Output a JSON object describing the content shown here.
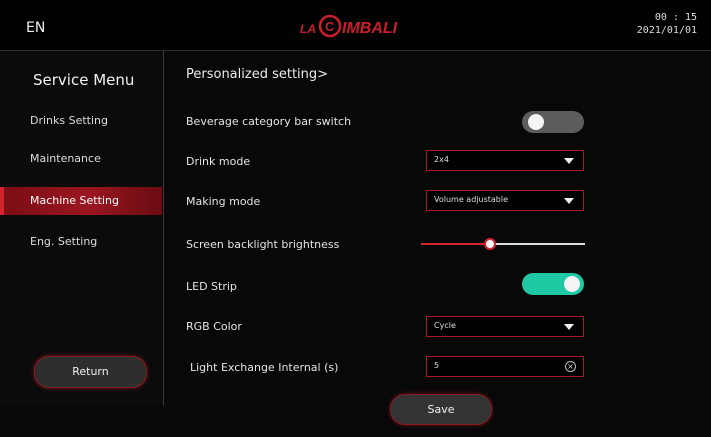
{
  "header": {
    "language": "EN",
    "logo_text": "LA CIMBALI",
    "time": "00 : 15",
    "date": "2021/01/01"
  },
  "sidebar": {
    "title": "Service Menu",
    "items": [
      {
        "label": "Drinks Setting",
        "active": false
      },
      {
        "label": "Maintenance",
        "active": false
      },
      {
        "label": "Machine Setting",
        "active": true
      },
      {
        "label": "Eng. Setting",
        "active": false
      }
    ],
    "return_label": "Return"
  },
  "main": {
    "breadcrumb": "Personalized setting>",
    "rows": {
      "beverage_bar": {
        "label": "Beverage category bar switch",
        "enabled": false
      },
      "drink_mode": {
        "label": "Drink mode",
        "value": "2x4"
      },
      "making_mode": {
        "label": "Making mode",
        "value": "Volume adjustable"
      },
      "brightness": {
        "label": "Screen backlight brightness",
        "level_percent": 42
      },
      "led_strip": {
        "label": "LED Strip",
        "enabled": true
      },
      "rgb_color": {
        "label": "RGB Color",
        "value": "Cycle"
      },
      "light_interval": {
        "label": "Light Exchange Internal (s)",
        "value": "5"
      }
    },
    "save_label": "Save"
  },
  "colors": {
    "accent_red": "#d2232f",
    "toggle_on": "#1fc9a4",
    "toggle_off": "#5c5c5c"
  },
  "icons": [
    "chevron-down-icon",
    "clear-icon"
  ]
}
